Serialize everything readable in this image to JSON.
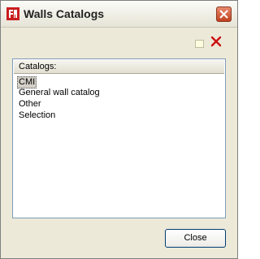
{
  "window": {
    "title": "Walls Catalogs"
  },
  "toolbar": {
    "new_icon": "new-item-icon",
    "delete_icon": "delete-x-icon"
  },
  "catalogs": {
    "header": "Catalogs:",
    "items": [
      "CMI",
      "General wall catalog",
      "Other",
      "Selection"
    ],
    "selected": "CMI"
  },
  "buttons": {
    "close_label": "Close"
  },
  "colors": {
    "close_button_red": "#c1401d",
    "delete_icon_red": "#cc1111",
    "list_border": "#7f9db9"
  }
}
